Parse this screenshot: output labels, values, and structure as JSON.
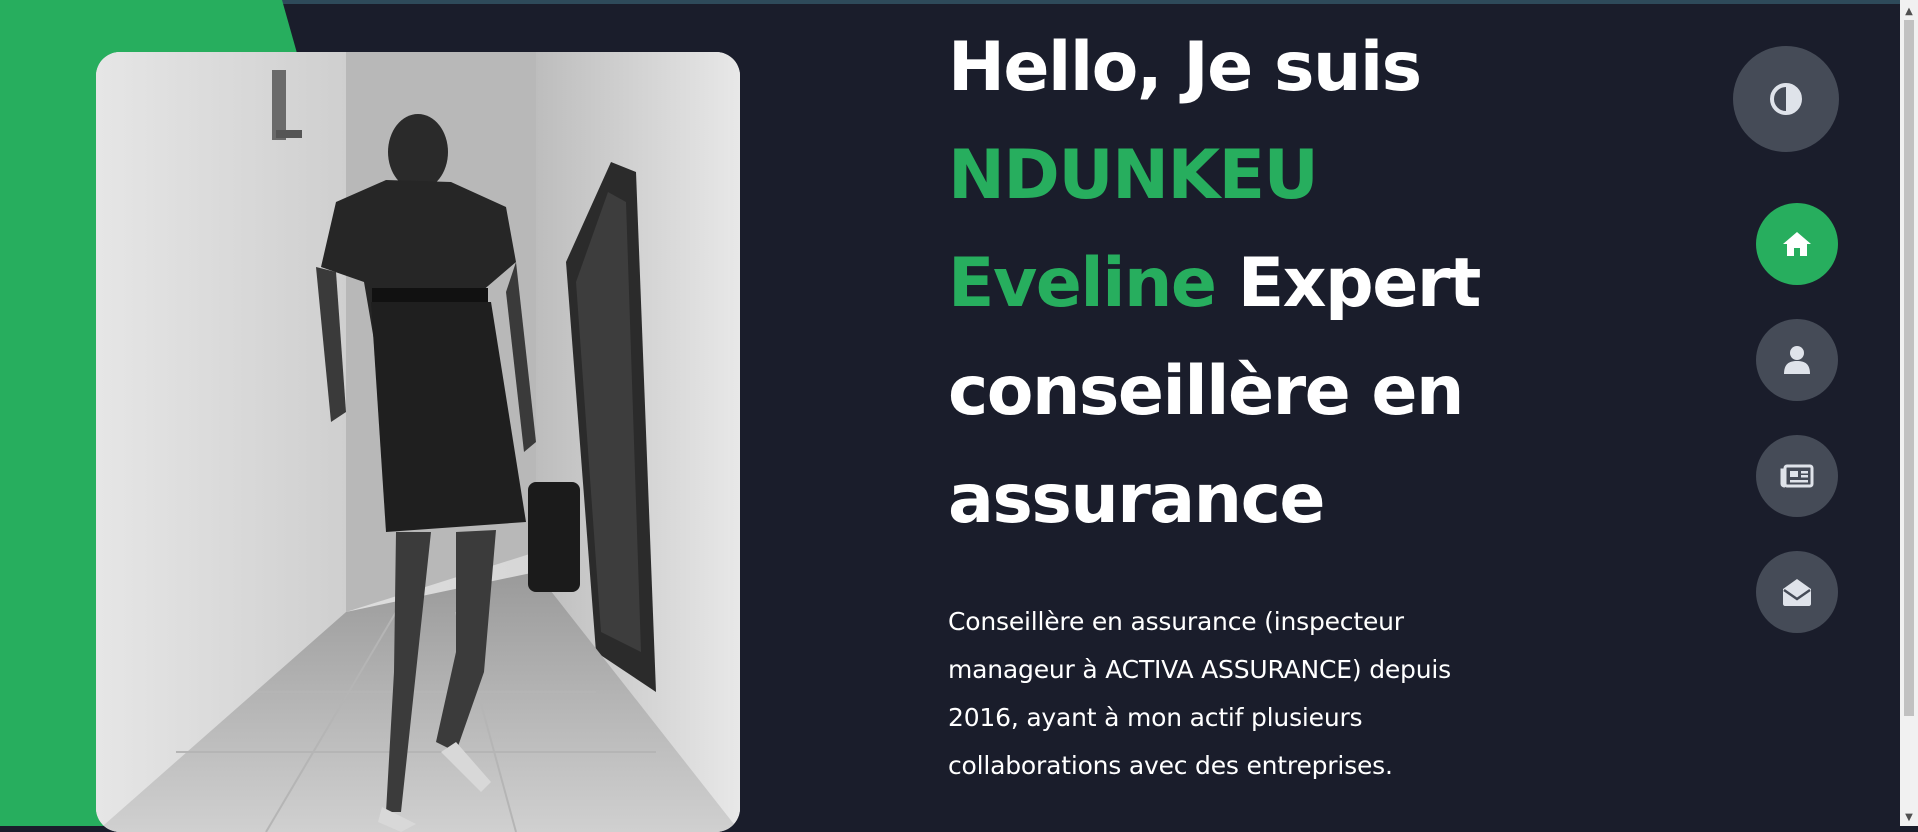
{
  "hero": {
    "greeting": "Hello, Je suis",
    "first_name": "NDUNKEU",
    "last_name": "Eveline",
    "role_line1": "Expert",
    "role_line2": "conseillère en",
    "role_line3": "assurance",
    "description": "Conseillère en assurance (inspecteur manageur à ACTIVA ASSURANCE) depuis 2016, ayant à mon actif plusieurs collaborations avec des entreprises."
  },
  "nav": {
    "theme_icon": "half-circle-contrast-icon",
    "items": [
      {
        "name": "home",
        "icon": "house-icon",
        "active": true
      },
      {
        "name": "about",
        "icon": "user-icon",
        "active": false
      },
      {
        "name": "portfolio",
        "icon": "newspaper-icon",
        "active": false
      },
      {
        "name": "contact",
        "icon": "envelope-open-icon",
        "active": false
      }
    ]
  },
  "colors": {
    "accent": "#27ae5e",
    "background": "#1a1d2b",
    "button": "#454b57",
    "text": "#ffffff",
    "icon": "#dfe3ea"
  }
}
